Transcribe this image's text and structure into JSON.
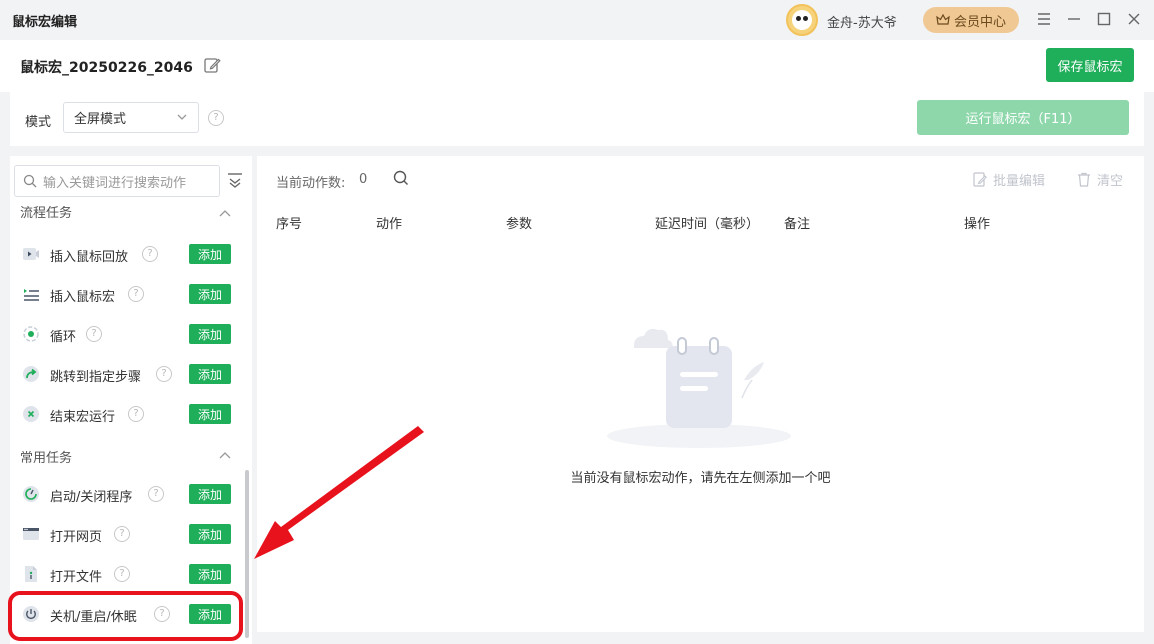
{
  "titlebar": {
    "app_title": "鼠标宏编辑",
    "username": "金舟-苏大爷",
    "vip_label": "会员中心"
  },
  "header": {
    "macro_name": "鼠标宏_20250226_2046",
    "save_label": "保存鼠标宏"
  },
  "mode": {
    "label": "模式",
    "selected": "全屏模式",
    "run_label": "运行鼠标宏（F11）"
  },
  "sidebar": {
    "search_placeholder": "输入关键词进行搜索动作",
    "add_label": "添加",
    "sections": [
      {
        "title": "流程任务",
        "items": [
          {
            "label": "插入鼠标回放",
            "icon": "video-icon"
          },
          {
            "label": "插入鼠标宏",
            "icon": "list-play-icon"
          },
          {
            "label": "循环",
            "icon": "loop-icon"
          },
          {
            "label": "跳转到指定步骤",
            "icon": "jump-arrow-icon"
          },
          {
            "label": "结束宏运行",
            "icon": "stop-x-icon"
          }
        ]
      },
      {
        "title": "常用任务",
        "items": [
          {
            "label": "启动/关闭程序",
            "icon": "program-icon"
          },
          {
            "label": "打开网页",
            "icon": "browser-icon"
          },
          {
            "label": "打开文件",
            "icon": "file-icon"
          },
          {
            "label": "关机/重启/休眠",
            "icon": "power-icon"
          }
        ]
      }
    ]
  },
  "actions": {
    "count_label": "当前动作数:",
    "count_value": "0",
    "batch_edit": "批量编辑",
    "clear": "清空",
    "columns": [
      "序号",
      "动作",
      "参数",
      "延迟时间（毫秒）",
      "备注",
      "操作"
    ],
    "empty_text": "当前没有鼠标宏动作，请先在左侧添加一个吧"
  },
  "colors": {
    "accent": "#1fae59",
    "accent_disabled": "#8dd7ab",
    "annotation": "#e8121d",
    "vip": "#f0c894"
  }
}
